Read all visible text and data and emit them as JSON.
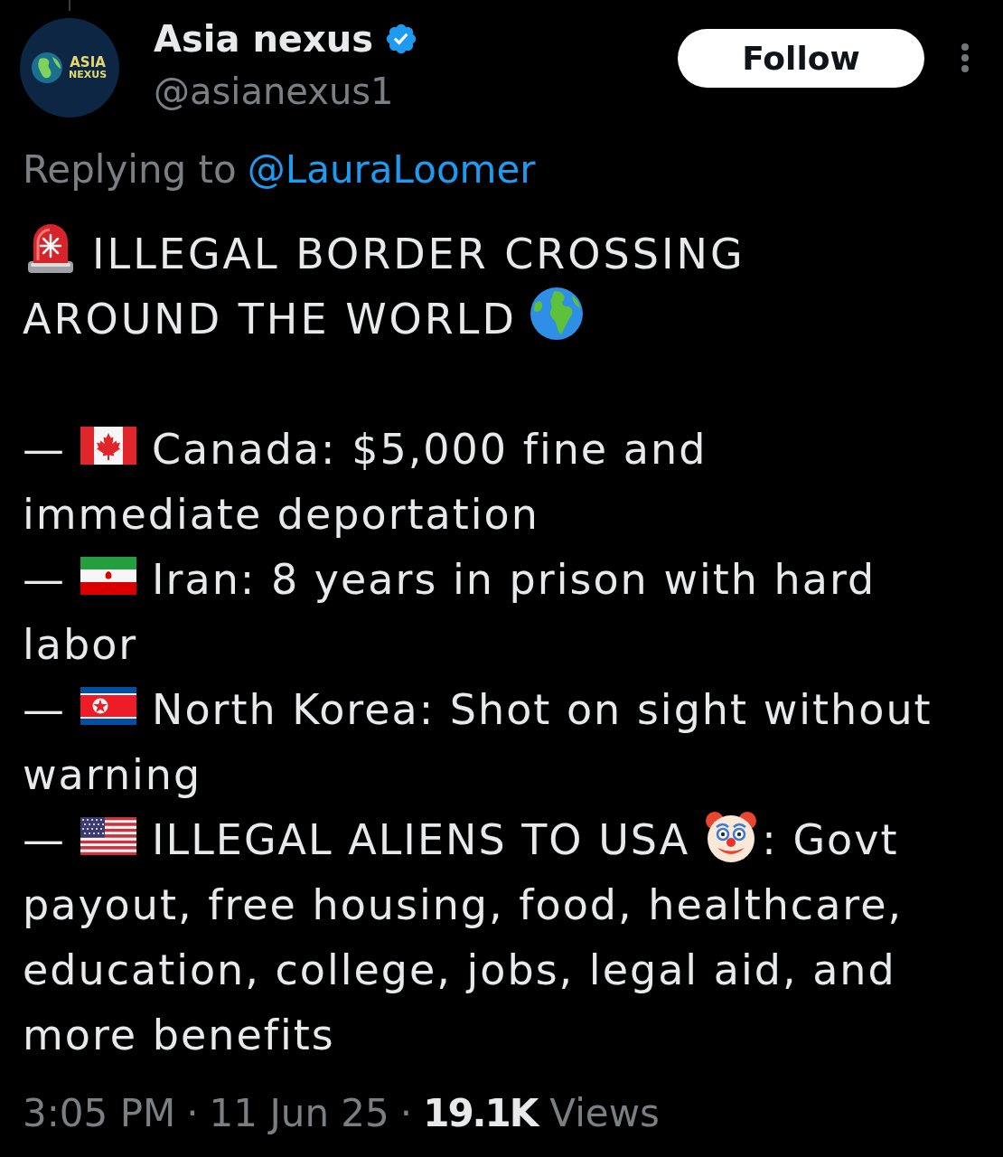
{
  "author": {
    "avatar_text": [
      "ASIA",
      "NEXUS"
    ],
    "name": "Asia nexus",
    "verified": true,
    "handle": "@asianexus1"
  },
  "follow_button": {
    "label": "Follow"
  },
  "reply_context": {
    "prefix": "Replying to",
    "mention": "@LauraLoomer"
  },
  "body": {
    "paragraphs": [
      {
        "kind": "headline",
        "lines": [
          [
            {
              "kind": "siren"
            },
            {
              "kind": "text",
              "text": "ILLEGAL BORDER CROSSING"
            }
          ],
          [
            {
              "kind": "text",
              "text": "AROUND THE WORLD"
            },
            {
              "kind": "globe"
            }
          ]
        ]
      },
      {
        "kind": "item",
        "lines": [
          [
            {
              "kind": "dash",
              "text": "—"
            },
            {
              "kind": "canada"
            },
            {
              "kind": "text",
              "text": "Canada: $5,000 fine and"
            }
          ],
          [
            {
              "kind": "text",
              "text": "immediate deportation"
            }
          ]
        ]
      },
      {
        "kind": "item",
        "lines": [
          [
            {
              "kind": "dash",
              "text": "—"
            },
            {
              "kind": "iran"
            },
            {
              "kind": "text",
              "text": "Iran: 8 years in prison with hard"
            }
          ],
          [
            {
              "kind": "text",
              "text": "labor"
            }
          ]
        ]
      },
      {
        "kind": "item",
        "lines": [
          [
            {
              "kind": "dash",
              "text": "—"
            },
            {
              "kind": "northkorea"
            },
            {
              "kind": "text",
              "text": "North Korea: Shot on sight without"
            }
          ],
          [
            {
              "kind": "text",
              "text": "warning"
            }
          ]
        ]
      },
      {
        "kind": "item",
        "lines": [
          [
            {
              "kind": "dash",
              "text": "—"
            },
            {
              "kind": "usa"
            },
            {
              "kind": "text",
              "text": "ILLEGAL ALIENS TO USA"
            },
            {
              "kind": "clown"
            },
            {
              "kind": "text",
              "text": ": Govt"
            }
          ],
          [
            {
              "kind": "text",
              "text": "payout, free housing, food, healthcare,"
            }
          ],
          [
            {
              "kind": "text",
              "text": "education, college, jobs, legal aid, and"
            }
          ],
          [
            {
              "kind": "text",
              "text": "more benefits"
            }
          ]
        ]
      }
    ]
  },
  "meta": [
    {
      "kind": "time",
      "text": "3:05 PM"
    },
    {
      "kind": "separator",
      "text": "·"
    },
    {
      "kind": "date",
      "text": "11 Jun 25"
    },
    {
      "kind": "separator",
      "text": "·"
    },
    {
      "kind": "count",
      "text": "19.1K"
    },
    {
      "kind": "label",
      "text": "Views"
    }
  ]
}
